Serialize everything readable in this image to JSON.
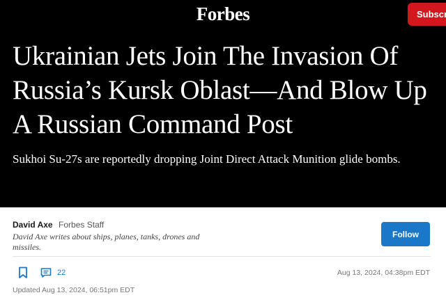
{
  "header": {
    "logo": "Forbes",
    "subscribe_label": "Subscri"
  },
  "article": {
    "headline": "Ukrainian Jets Join The Invasion Of Russia’s Kursk Oblast—And Blow Up A Russian Command Post",
    "dek": "Sukhoi Su-27s are reportedly dropping Joint Direct Attack Munition glide bombs."
  },
  "author": {
    "name": "David Axe",
    "role": "Forbes Staff",
    "bio": "David Axe writes about ships, planes, tanks, drones and missiles.",
    "follow_label": "Follow"
  },
  "meta": {
    "comment_count": "22",
    "published": "Aug 13, 2024, 04:38pm EDT",
    "updated": "Updated Aug 13, 2024, 06:51pm EDT"
  },
  "colors": {
    "subscribe_red": "#d4161f",
    "follow_blue": "#1b77c8",
    "hero_bg": "#000000"
  },
  "icons": {
    "bookmark": "bookmark-icon",
    "comments": "comment-icon"
  }
}
